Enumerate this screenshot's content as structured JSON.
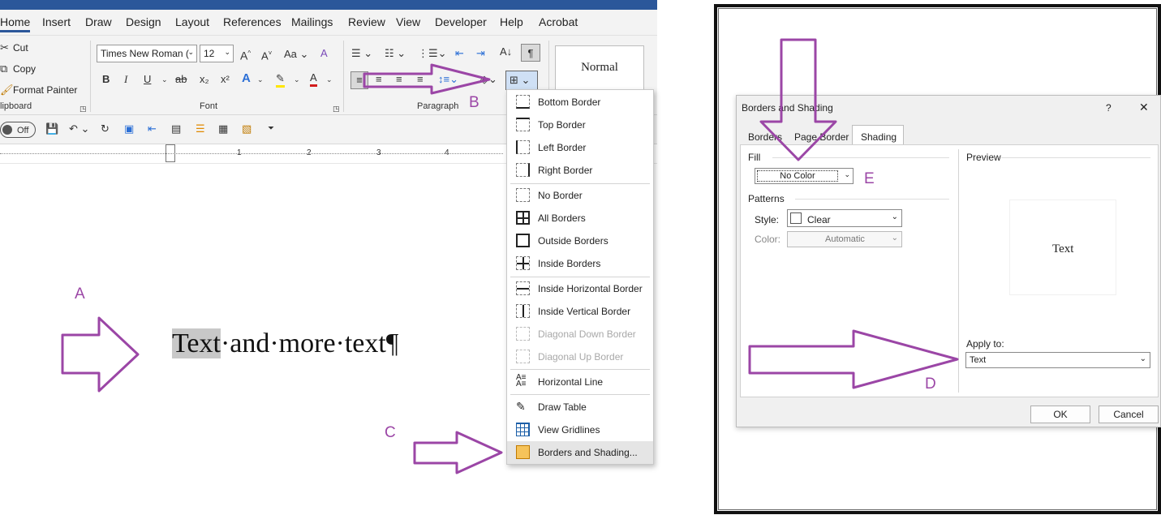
{
  "ribbon": {
    "tabs": [
      "Home",
      "Insert",
      "Draw",
      "Design",
      "Layout",
      "References",
      "Mailings",
      "Review",
      "View",
      "Developer",
      "Help",
      "Acrobat"
    ],
    "clipboard": {
      "cut": "Cut",
      "copy": "Copy",
      "format_painter": "Format Painter",
      "group": "lipboard"
    },
    "font": {
      "name": "Times New Roman (",
      "size": "12",
      "group": "Font",
      "grow": "A^",
      "shrink": "A˅",
      "case": "Aa",
      "bold": "B",
      "italic": "I",
      "underline": "U",
      "strike": "ab",
      "sub": "x₂",
      "sup": "x²"
    },
    "paragraph": {
      "group": "Paragraph"
    },
    "styles": {
      "normal": "Normal"
    }
  },
  "qat": {
    "toggle": "Off"
  },
  "ruler": {
    "marks": [
      "1",
      "2",
      "3",
      "4"
    ]
  },
  "document": {
    "highlighted": "Text",
    "rest": "·and·more·text¶"
  },
  "borders_menu": {
    "items": [
      {
        "label": "Bottom Border"
      },
      {
        "label": "Top Border"
      },
      {
        "label": "Left Border"
      },
      {
        "label": "Right Border"
      },
      {
        "label": "No Border"
      },
      {
        "label": "All Borders"
      },
      {
        "label": "Outside Borders"
      },
      {
        "label": "Inside Borders"
      },
      {
        "label": "Inside Horizontal Border"
      },
      {
        "label": "Inside Vertical Border"
      },
      {
        "label": "Diagonal Down Border"
      },
      {
        "label": "Diagonal Up Border"
      },
      {
        "label": "Horizontal Line"
      },
      {
        "label": "Draw Table"
      },
      {
        "label": "View Gridlines"
      },
      {
        "label": "Borders and Shading..."
      }
    ]
  },
  "annotations": {
    "a": "A",
    "b": "B",
    "c": "C",
    "d": "D",
    "e": "E"
  },
  "dialog": {
    "title": "Borders and Shading",
    "help": "?",
    "close": "✕",
    "tabs": [
      "Borders",
      "Page Border",
      "Shading"
    ],
    "fill_label": "Fill",
    "fill_value": "No Color",
    "patterns_label": "Patterns",
    "style_label": "Style:",
    "style_value": "Clear",
    "color_label": "Color:",
    "color_value": "Automatic",
    "preview_label": "Preview",
    "preview_text": "Text",
    "apply_label": "Apply to:",
    "apply_value": "Text",
    "ok": "OK",
    "cancel": "Cancel"
  },
  "colors": {
    "accent": "#9b46a6",
    "ribbon_blue": "#2b579a"
  }
}
